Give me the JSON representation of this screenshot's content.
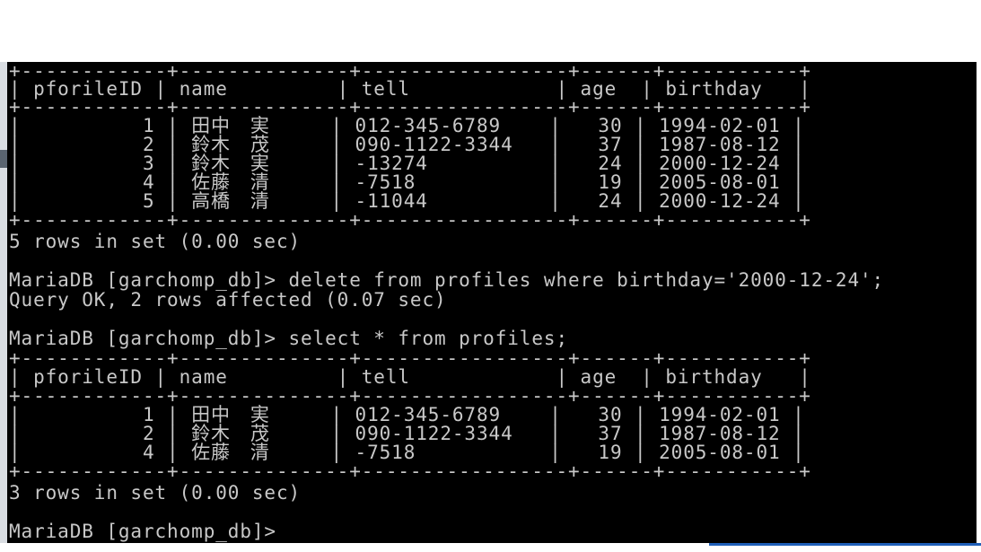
{
  "terminal": {
    "lines": [
      "+------------+--------------+-----------------+------+-----------+",
      "| pforileID | name         | tell            | age  | birthday   |",
      "+------------+--------------+-----------------+------+-----------+",
      "|          1 | 田中　実     | 012-345-6789    |   30 | 1994-02-01 |",
      "|          2 | 鈴木　茂     | 090-1122-3344   |   37 | 1987-08-12 |",
      "|          3 | 鈴木　実     | -13274          |   24 | 2000-12-24 |",
      "|          4 | 佐藤　清     | -7518           |   19 | 2005-08-01 |",
      "|          5 | 高橋　清     | -11044          |   24 | 2000-12-24 |",
      "+------------+--------------+-----------------+------+-----------+",
      "5 rows in set (0.00 sec)",
      "",
      "MariaDB [garchomp_db]> delete from profiles where birthday='2000-12-24';",
      "Query OK, 2 rows affected (0.07 sec)",
      "",
      "MariaDB [garchomp_db]> select * from profiles;",
      "+------------+--------------+-----------------+------+-----------+",
      "| pforileID | name         | tell            | age  | birthday   |",
      "+------------+--------------+-----------------+------+-----------+",
      "|          1 | 田中　実     | 012-345-6789    |   30 | 1994-02-01 |",
      "|          2 | 鈴木　茂     | 090-1122-3344   |   37 | 1987-08-12 |",
      "|          4 | 佐藤　清     | -7518           |   19 | 2005-08-01 |",
      "+------------+--------------+-----------------+------+-----------+",
      "3 rows in set (0.00 sec)",
      "",
      "MariaDB [garchomp_db]>"
    ]
  },
  "colors": {
    "console_background": "#000000",
    "console_text": "#c8c8c8"
  }
}
